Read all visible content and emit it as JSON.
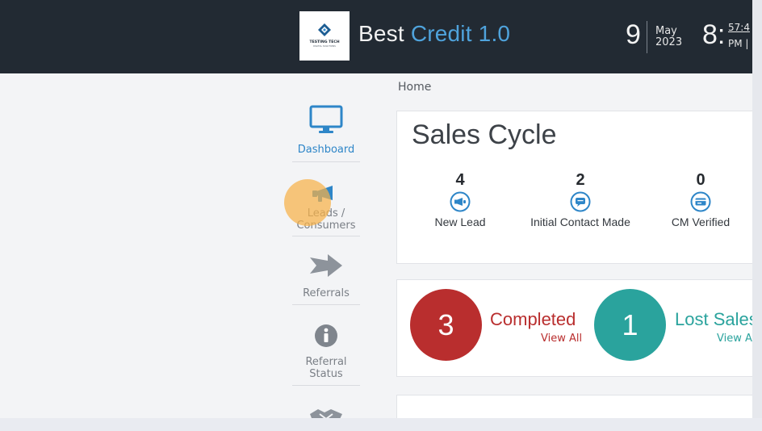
{
  "header": {
    "brand_line1": "TESTING TECH",
    "brand_line2": "DIGITAL SOLUTIONS",
    "title_main": "Best",
    "title_accent": "Credit 1.0",
    "day": "9",
    "month": "May",
    "year": "2023",
    "hour": "8:",
    "minutes": "57:4",
    "ampm": "PM |",
    "colors": {
      "bar": "#222a33",
      "accent": "#4fa3dc"
    }
  },
  "sidebar": {
    "items": [
      {
        "id": "dashboard",
        "label": "Dashboard",
        "icon": "monitor-icon",
        "active": true
      },
      {
        "id": "leads",
        "label_line1": "Leads /",
        "label_line2": "Consumers",
        "icon": "megaphone-icon"
      },
      {
        "id": "referrals",
        "label": "Referrals",
        "icon": "arrow-right-icon"
      },
      {
        "id": "referral-status",
        "label_line1": "Referral",
        "label_line2": "Status",
        "icon": "info-icon"
      },
      {
        "id": "partners",
        "icon": "handshake-icon"
      }
    ]
  },
  "breadcrumb": "Home",
  "sales_cycle": {
    "title": "Sales Cycle",
    "stages": [
      {
        "count": "4",
        "label": "New Lead",
        "icon": "megaphone-icon"
      },
      {
        "count": "2",
        "label": "Initial Contact Made",
        "icon": "chat-icon"
      },
      {
        "count": "0",
        "label": "CM Verified",
        "icon": "id-card-icon"
      }
    ]
  },
  "summary": {
    "completed": {
      "count": "3",
      "label": "Completed",
      "link": "View All",
      "color": "#b92e2e"
    },
    "lost": {
      "count": "1",
      "label": "Lost Sales",
      "link": "View All",
      "color": "#2aa39d"
    }
  }
}
